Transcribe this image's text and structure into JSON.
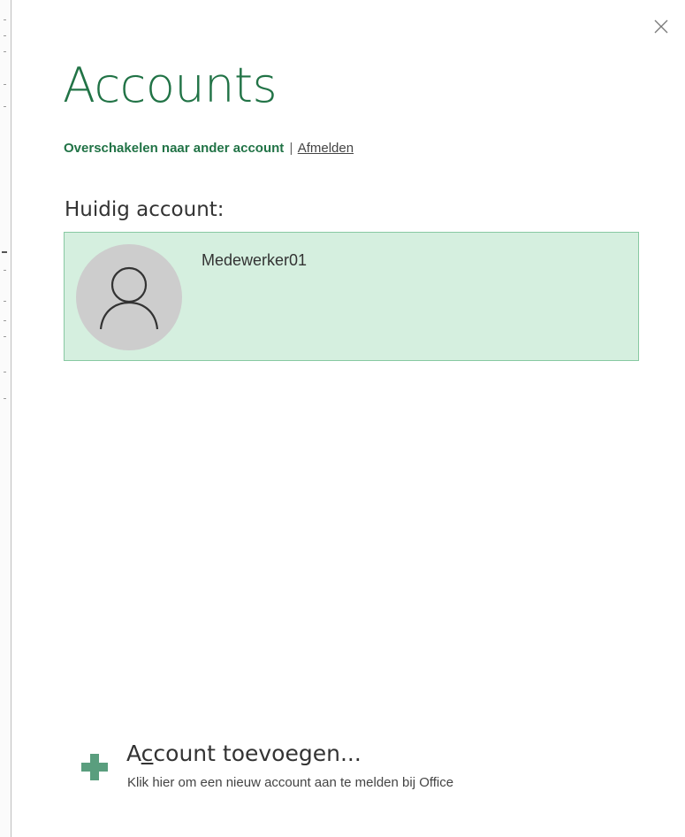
{
  "header": {
    "title": "Accounts",
    "close_icon": "close-icon"
  },
  "links": {
    "switch_account": "Overschakelen naar ander account",
    "separator": "|",
    "sign_out": "Afmelden"
  },
  "current_account": {
    "heading": "Huidig account:",
    "name": "Medewerker01",
    "avatar_icon": "user-icon"
  },
  "add_account": {
    "title_prefix": "A",
    "title_accel": "c",
    "title_suffix": "count toevoegen...",
    "description": "Klik hier om een nieuw account aan te melden bij Office",
    "icon": "plus-icon"
  },
  "colors": {
    "accent": "#217346",
    "card_background": "#d5efdf",
    "card_border": "#88c9a2",
    "plus_icon": "#5a9e7e",
    "avatar_background": "#cdcdcd"
  }
}
